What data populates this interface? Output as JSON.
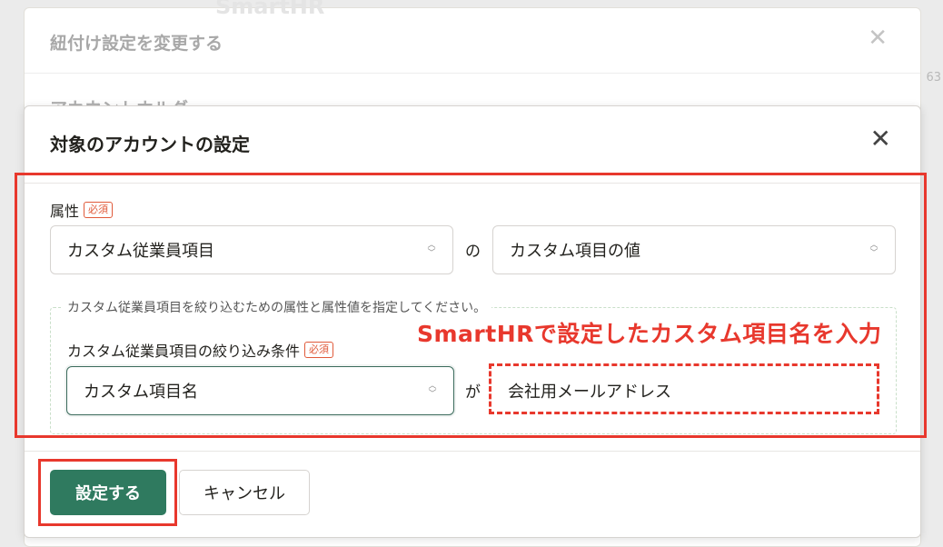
{
  "background_dialog": {
    "logo_text": "SmartHR",
    "title": "紐付け設定を変更する",
    "section_label": "アカウントホルダ",
    "side_number": "63"
  },
  "dialog": {
    "title": "対象のアカウントの設定",
    "close_label": "✕",
    "attribute": {
      "label": "属性",
      "required_badge": "必須",
      "select_value": "カスタム従業員項目",
      "connector": "の",
      "value_select": "カスタム項目の値"
    },
    "filter": {
      "legend": "カスタム従業員項目を絞り込むための属性と属性値を指定してください。",
      "label": "カスタム従業員項目の絞り込み条件",
      "required_badge": "必須",
      "select_value": "カスタム項目名",
      "connector": "が",
      "input_value": "会社用メールアドレス"
    },
    "footer": {
      "submit_label": "設定する",
      "cancel_label": "キャンセル"
    }
  },
  "annotation": {
    "text": "SmartHRで設定したカスタム項目名を入力",
    "color": "#e8382d"
  },
  "colors": {
    "primary": "#2f7a5f",
    "required": "#e05a3a",
    "annotation": "#e8382d"
  }
}
